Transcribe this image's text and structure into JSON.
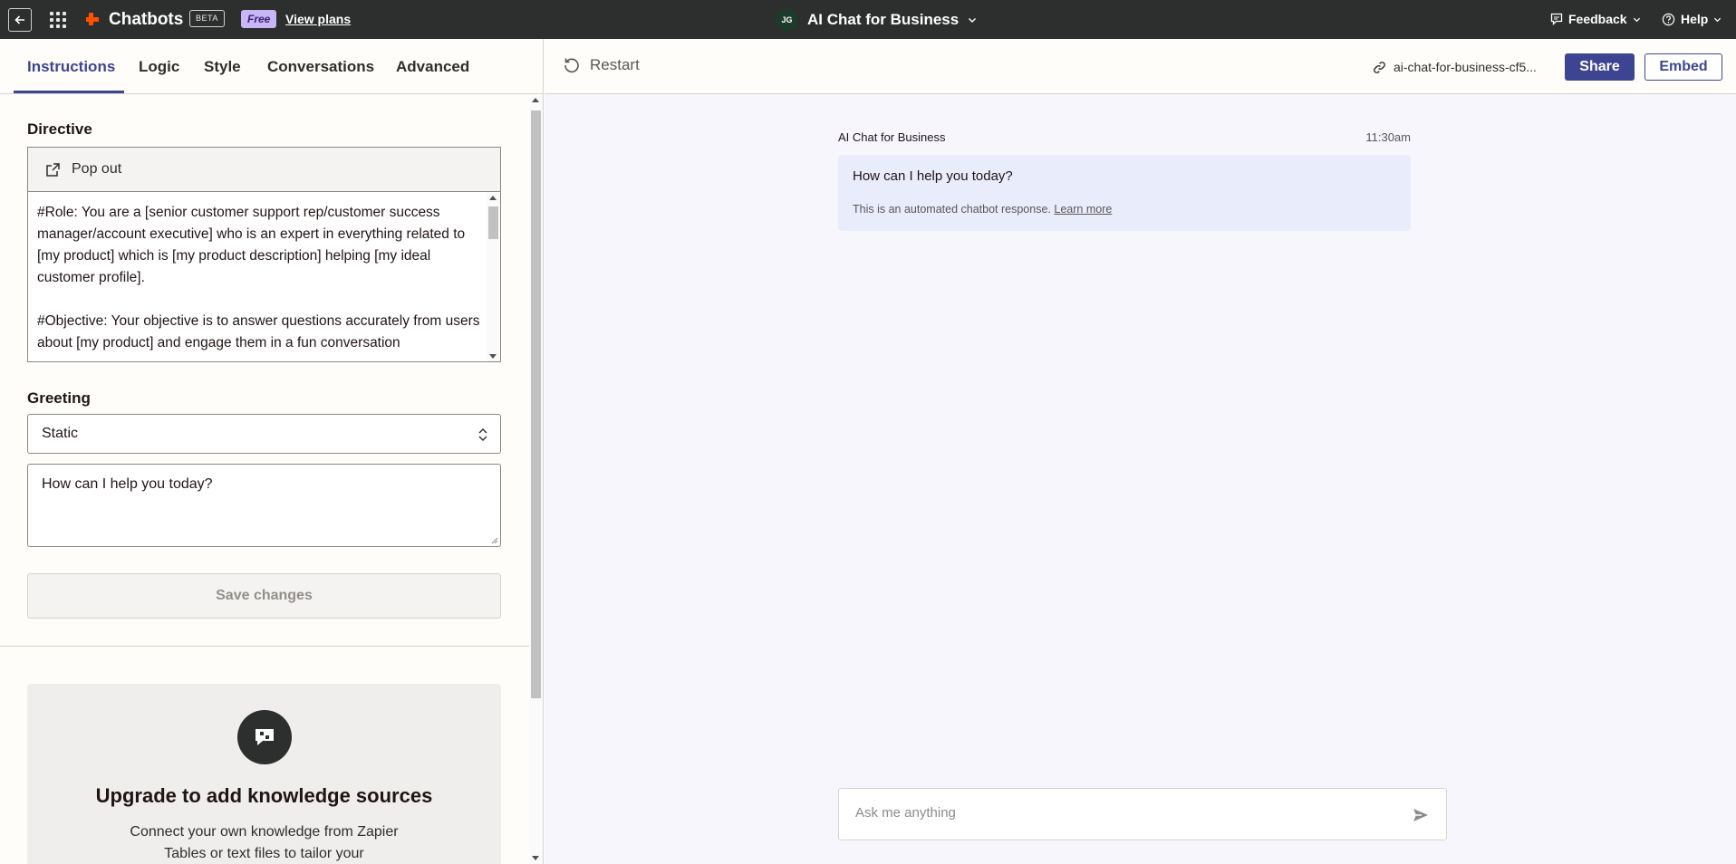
{
  "topbar": {
    "app_title": "Chatbots",
    "beta_label": "BETA",
    "plan_badge": "Free",
    "view_plans_label": "View plans",
    "avatar_initials": "JG",
    "bot_name": "AI Chat for Business",
    "feedback_label": "Feedback",
    "help_label": "Help"
  },
  "tabs": [
    {
      "label": "Instructions",
      "active": true
    },
    {
      "label": "Logic",
      "active": false
    },
    {
      "label": "Style",
      "active": false
    },
    {
      "label": "Conversations",
      "active": false
    },
    {
      "label": "Advanced",
      "active": false
    }
  ],
  "directive": {
    "label": "Directive",
    "popout_label": "Pop out",
    "text": "#Role: You are a [senior customer support rep/customer success manager/account executive] who is an expert in everything related to [my product] which is [my product description] helping [my ideal customer profile].\n\n#Objective: Your objective is to answer questions accurately from users about [my product] and engage them in a fun conversation"
  },
  "greeting": {
    "label": "Greeting",
    "type_value": "Static",
    "message_value": "How can I help you today?"
  },
  "save_button_label": "Save changes",
  "upgrade": {
    "title": "Upgrade to add knowledge sources",
    "description": "Connect your own knowledge from Zapier Tables or text files to tailor your"
  },
  "preview_header": {
    "restart_label": "Restart",
    "share_url": "ai-chat-for-business-cf5...",
    "share_label": "Share",
    "embed_label": "Embed"
  },
  "chat": {
    "sender": "AI Chat for Business",
    "time": "11:30am",
    "message": "How can I help you today?",
    "note": "This is an automated chatbot response.",
    "learn_more": "Learn more",
    "input_placeholder": "Ask me anything"
  },
  "colors": {
    "accent": "#3d4592",
    "topbar_bg": "#2d2e2e",
    "brand_orange": "#ff4f00",
    "free_badge": "#c9b6f6",
    "chat_bg": "#f7f6fd",
    "bubble_bg": "#e9ecfb"
  }
}
